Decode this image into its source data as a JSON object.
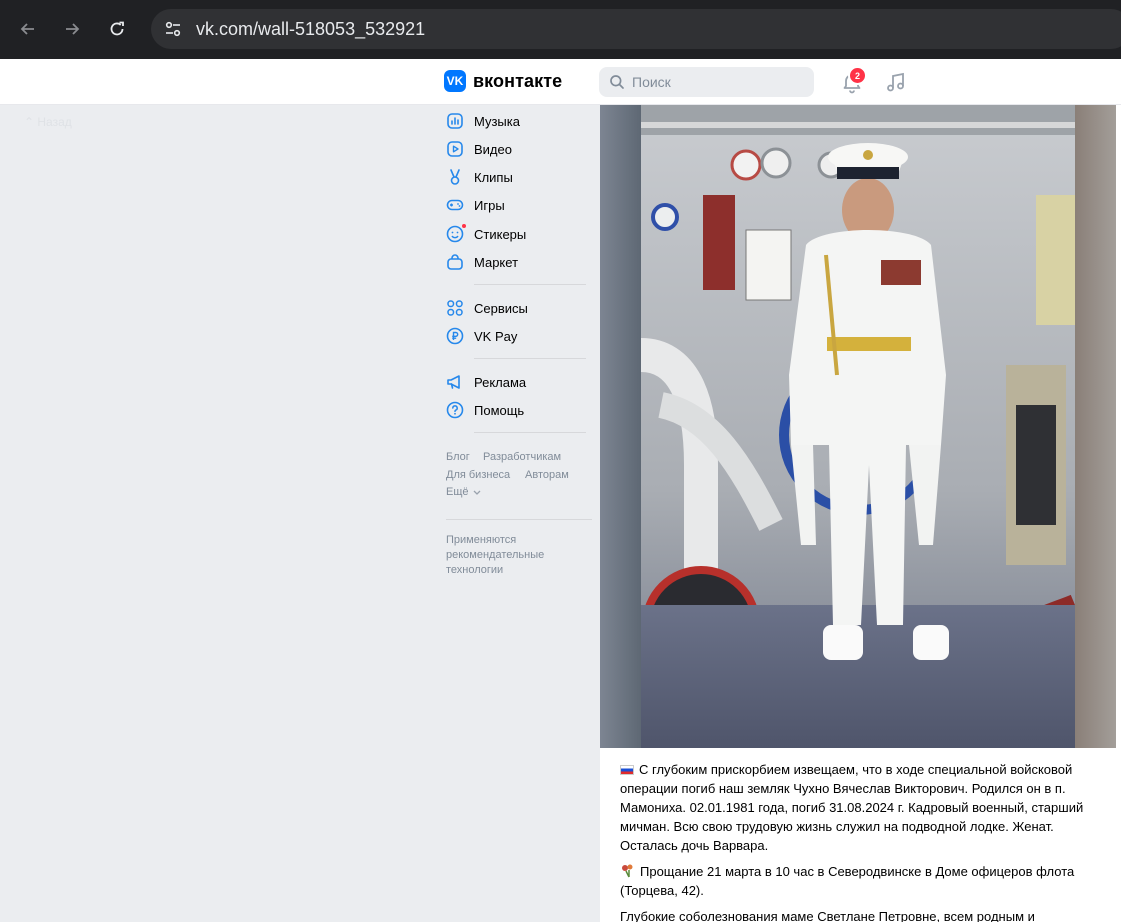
{
  "browser": {
    "url": "vk.com/wall-518053_532921"
  },
  "header": {
    "logo_text": "вконтакте",
    "search_placeholder": "Поиск",
    "notification_count": "2"
  },
  "faded_item": "Назад",
  "menu": {
    "items": [
      {
        "label": "Музыка",
        "icon": "music-chart-icon"
      },
      {
        "label": "Видео",
        "icon": "video-icon"
      },
      {
        "label": "Клипы",
        "icon": "clips-icon"
      },
      {
        "label": "Игры",
        "icon": "gamepad-icon"
      },
      {
        "label": "Стикеры",
        "icon": "sticker-icon"
      },
      {
        "label": "Маркет",
        "icon": "market-bag-icon"
      }
    ],
    "services": [
      {
        "label": "Сервисы",
        "icon": "services-grid-icon"
      },
      {
        "label": "VK Pay",
        "icon": "vk-pay-icon"
      }
    ],
    "support": [
      {
        "label": "Реклама",
        "icon": "megaphone-icon"
      },
      {
        "label": "Помощь",
        "icon": "help-icon"
      }
    ]
  },
  "footer": {
    "links": [
      "Блог",
      "Разработчикам",
      "Для бизнеса",
      "Авторам"
    ],
    "more": "Ещё",
    "recommendation_note": "Применяются рекомендательные технологии"
  },
  "post": {
    "paragraph_1": "С глубоким прискорбием извещаем, что в ходе специальной войсковой операции погиб наш земляк Чухно Вячеслав Викторович. Родился он в п. Мамониха. 02.01.1981 года, погиб 31.08.2024 г. Кадровый военный, старший мичман. Всю свою трудовую жизнь служил на подводной лодке. Женат. Осталась дочь Варвара.",
    "paragraph_2": "Прощание 21 марта в 10 час в Северодвинске в Доме офицеров флота (Торцева, 42).",
    "paragraph_3": "Глубокие соболезнования маме Светлане Петровне, всем родным и"
  },
  "colors": {
    "vk_blue": "#0077ff",
    "icon_blue": "#2688eb",
    "badge_red": "#ff3347",
    "page_bg": "#ebedf0"
  }
}
